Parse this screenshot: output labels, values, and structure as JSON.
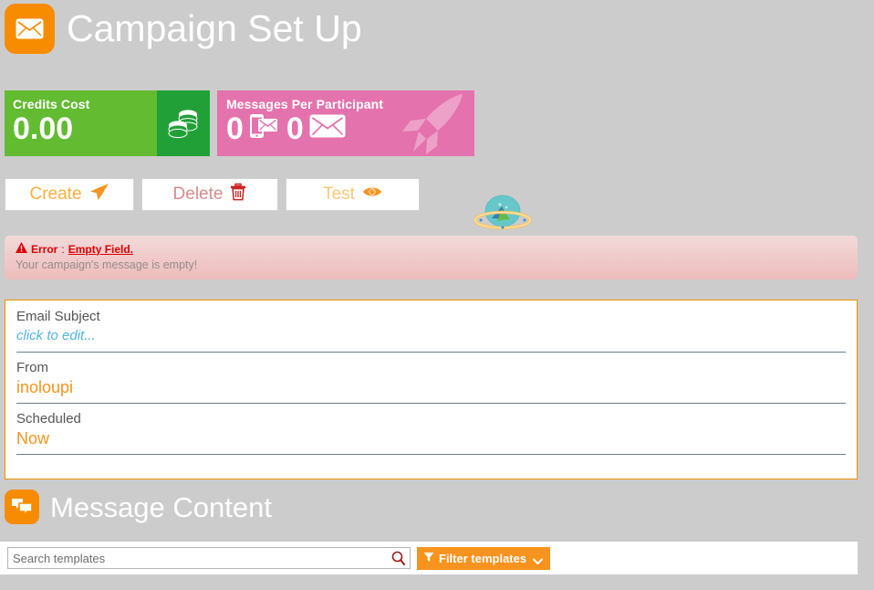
{
  "header": {
    "title": "Campaign Set Up",
    "icon": "envelope-icon"
  },
  "cards": [
    {
      "label": "Credits Cost",
      "value": "0.00",
      "icon": "coins-icon",
      "color": "#62bb31",
      "icon_panel_color": "#21a038"
    },
    {
      "label": "Messages Per Participant",
      "sms_count": "0",
      "email_count": "0",
      "sms_icon": "mobile-message-icon",
      "email_icon": "envelope-icon",
      "watermark_icon": "rocket-icon",
      "color": "#e472ad"
    }
  ],
  "actions": [
    {
      "label": "Create",
      "icon": "paper-plane-icon",
      "color": "#fbb040"
    },
    {
      "label": "Delete",
      "icon": "trash-icon",
      "color": "#d88b8b"
    },
    {
      "label": "Test",
      "icon": "eye-icon",
      "color": "#fcc87a"
    }
  ],
  "decoration": {
    "icon": "ufo-planet-icon"
  },
  "alert": {
    "icon": "warning-triangle-icon",
    "label": "Error",
    "separator": ":",
    "strong": "Empty Field.",
    "message": "Your campaign's message is empty!"
  },
  "details": {
    "fields": [
      {
        "label": "Email Subject",
        "value": "click to edit...",
        "style": "placeholder"
      },
      {
        "label": "From",
        "value": "inoloupi",
        "style": "orange"
      },
      {
        "label": "Scheduled",
        "value": "Now",
        "style": "orange"
      }
    ]
  },
  "message_content": {
    "title": "Message Content",
    "icon": "chat-bubbles-icon"
  },
  "search": {
    "placeholder": "Search templates",
    "value": "",
    "icon": "magnifier-icon",
    "filter_label": "Filter templates",
    "filter_icon": "funnel-icon",
    "chevron_icon": "chevron-down-icon",
    "accent": "#f7931e"
  }
}
